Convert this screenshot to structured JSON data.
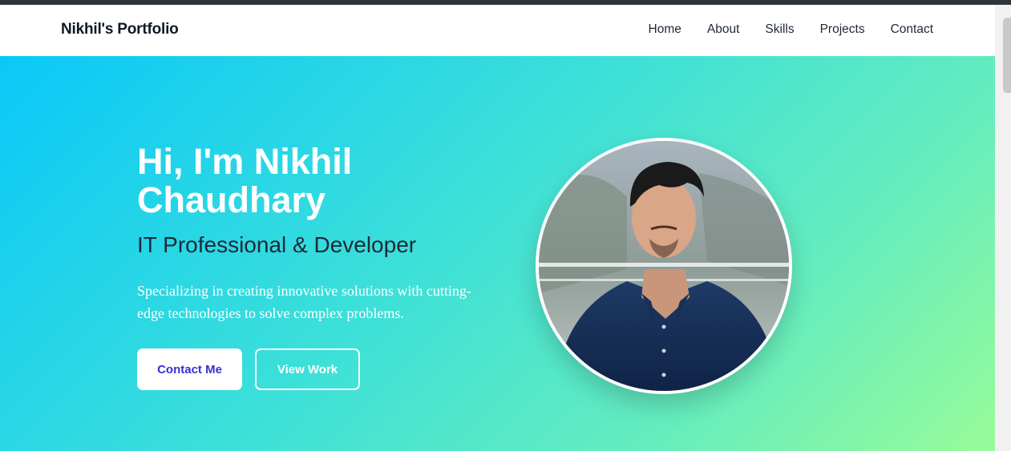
{
  "navbar": {
    "brand": "Nikhil's Portfolio",
    "links": [
      "Home",
      "About",
      "Skills",
      "Projects",
      "Contact"
    ]
  },
  "hero": {
    "title": "Hi, I'm Nikhil Chaudhary",
    "subtitle": "IT Professional & Developer",
    "description": "Specializing in creating innovative solutions with cutting-edge technologies to solve complex problems.",
    "primary_button": "Contact Me",
    "secondary_button": "View Work"
  },
  "colors": {
    "gradient_start": "#0ac8f8",
    "gradient_end": "#98fb98",
    "primary_button_text": "#3b2fd0",
    "brand_text": "#111827"
  }
}
